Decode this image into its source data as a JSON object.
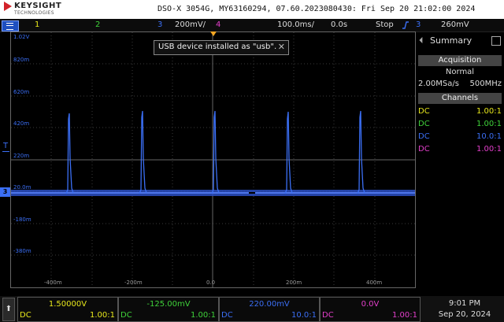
{
  "header": {
    "brand": "KEYSIGHT",
    "brand_sub": "TECHNOLOGIES",
    "model_line": "DSO-X 3054G, MY63160294, 07.60.2023080430: Fri Sep 20 21:02:00 2024"
  },
  "statusbar": {
    "ch1": "1",
    "ch2": "2",
    "ch3": "3",
    "ch3_scale": "200mV/",
    "ch4": "4",
    "timebase": "100.0ms/",
    "delay": "0.0s",
    "run_state": "Stop",
    "trigger_source": "3",
    "trigger_level": "260mV"
  },
  "notice": {
    "text": "USB device installed as \"usb\".",
    "close": "✕"
  },
  "y_labels": [
    "1.02V",
    "820m",
    "620m",
    "420m",
    "220m",
    "20.0m",
    "-180m",
    "-380m"
  ],
  "x_labels": [
    "-400m",
    "-200m",
    "0.0",
    "200m",
    "400m"
  ],
  "ch3_marker": "3",
  "trig_marker": "T",
  "panel": {
    "summary": "Summary",
    "acquisition_head": "Acquisition",
    "mode": "Normal",
    "sample_rate": "2.00MSa/s",
    "bandwidth": "500MHz",
    "channels_head": "Channels",
    "channels": [
      {
        "coupling": "DC",
        "probe": "1.00:1",
        "color": "#e8e81c"
      },
      {
        "coupling": "DC",
        "probe": "1.00:1",
        "color": "#3fd23a"
      },
      {
        "coupling": "DC",
        "probe": "10.0:1",
        "color": "#3b6ff5"
      },
      {
        "coupling": "DC",
        "probe": "1.00:1",
        "color": "#e33fcb"
      }
    ]
  },
  "bottom": {
    "softkey": "⬆",
    "ch1": {
      "value": "1.50000V",
      "coupling": "DC",
      "probe": "1.00:1"
    },
    "ch2": {
      "value": "-125.00mV",
      "coupling": "DC",
      "probe": "1.00:1"
    },
    "ch3": {
      "value": "220.00mV",
      "coupling": "DC",
      "probe": "10.0:1"
    },
    "ch4": {
      "value": "0.0V",
      "coupling": "DC",
      "probe": "1.00:1"
    },
    "time": "9:01 PM",
    "date": "Sep 20, 2024"
  },
  "colors": {
    "ch1": "#e8e81c",
    "ch2": "#3fd23a",
    "ch3": "#3b6ff5",
    "ch4": "#e33fcb",
    "trigger": "#f5a623"
  },
  "icons": {
    "menu": "menu-icon",
    "trigger_edge": "rising-edge-icon",
    "summary_arrow": "chevron-left-icon",
    "softkey_up": "up-arrow-icon"
  }
}
